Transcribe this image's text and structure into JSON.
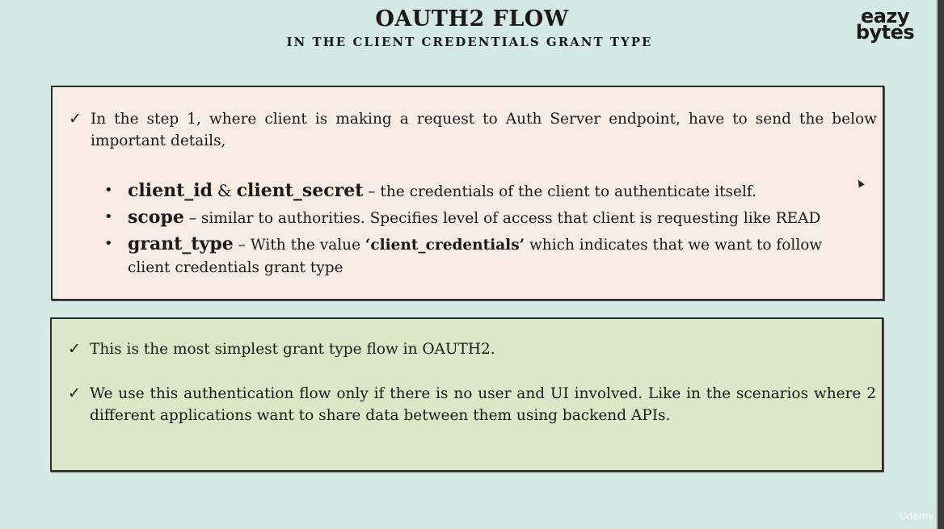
{
  "header": {
    "title": "OAUTH2 FLOW",
    "subtitle": "IN THE CLIENT CREDENTIALS GRANT TYPE"
  },
  "logo": {
    "line1": "eazy",
    "line2": "bytes"
  },
  "top_box": {
    "check_symbol": "✓",
    "intro": "In the step 1, where client is making a request to Auth Server endpoint, have to send the below important details,",
    "bullet_symbol": "•",
    "bullets": [
      {
        "term1": "client_id",
        "joiner": "&",
        "term2": "client_secret",
        "description": "– the credentials of the client to authenticate itself."
      },
      {
        "term": "scope",
        "description": "– similar to authorities. Specifies level of access that client is requesting like READ"
      },
      {
        "term": "grant_type",
        "description_before": "– With the value",
        "value": "‘client_credentials’",
        "description_after": "which indicates that we want to follow client credentials grant type"
      }
    ]
  },
  "bottom_box": {
    "check_symbol": "✓",
    "points": [
      "This is the most simplest grant type flow in OAUTH2.",
      "We use this authentication flow only if there is no user and UI involved. Like in the scenarios where 2 different applications want to share data between them using backend APIs."
    ]
  },
  "watermark": {
    "text": "Udemy"
  },
  "colors": {
    "background": "#d4e9e3",
    "top_box_fill": "#f8ebe1",
    "bottom_box_fill": "#dde6c8",
    "border": "#2c2c2c"
  }
}
